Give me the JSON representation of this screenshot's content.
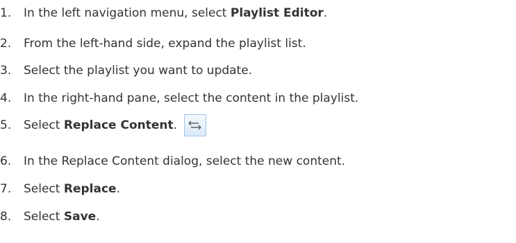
{
  "steps": [
    {
      "num": "1.",
      "pre": "In the left navigation menu, select ",
      "bold": "Playlist Editor",
      "post": "."
    },
    {
      "num": "2.",
      "pre": "From the left-hand side, expand the playlist list.",
      "bold": "",
      "post": ""
    },
    {
      "num": "3.",
      "pre": "Select the playlist you want to update.",
      "bold": "",
      "post": ""
    },
    {
      "num": "4.",
      "pre": "In the right-hand pane, select the content in the playlist.",
      "bold": "",
      "post": ""
    },
    {
      "num": "5.",
      "pre": "Select ",
      "bold": "Replace Content",
      "post": "."
    },
    {
      "num": "6.",
      "pre": "In the Replace Content dialog, select the new content.",
      "bold": "",
      "post": ""
    },
    {
      "num": "7.",
      "pre": "Select ",
      "bold": "Replace",
      "post": "."
    },
    {
      "num": "8.",
      "pre": "Select ",
      "bold": "Save",
      "post": "."
    }
  ],
  "icons": {
    "replace_content": "replace-content-icon"
  }
}
